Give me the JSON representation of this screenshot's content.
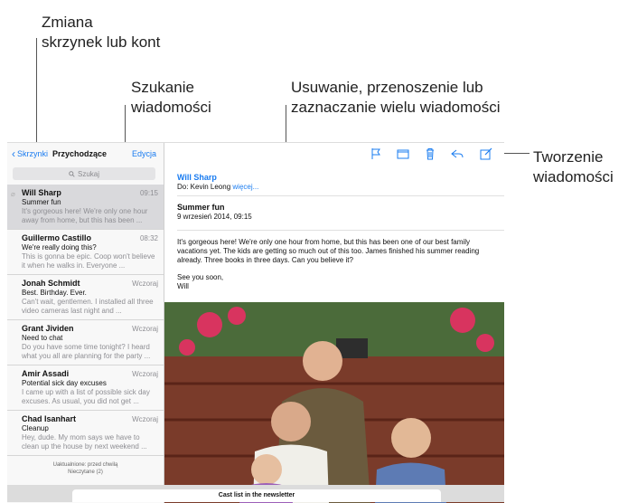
{
  "callouts": {
    "mailboxes": "Zmiana\nskrzynek lub kont",
    "search": "Szukanie\nwiadomości",
    "actions": "Usuwanie, przenoszenie lub\nzaznaczanie wielu wiadomości",
    "compose": "Tworzenie\nwiadomości"
  },
  "nav": {
    "back_label": "Skrzynki",
    "title": "Przychodzące",
    "edit_label": "Edycja"
  },
  "search": {
    "placeholder": "Szukaj"
  },
  "messages": [
    {
      "from": "Will Sharp",
      "date": "09:15",
      "subject": "Summer fun",
      "preview": "It's gorgeous here! We're only one hour away from home, but this has been ..."
    },
    {
      "from": "Guillermo Castillo",
      "date": "08:32",
      "subject": "We're really doing this?",
      "preview": "This is gonna be epic. Coop won't believe it when he walks in. Everyone ..."
    },
    {
      "from": "Jonah Schmidt",
      "date": "Wczoraj",
      "subject": "Best. Birthday. Ever.",
      "preview": "Can't wait, gentlemen. I installed all three video cameras last night and ..."
    },
    {
      "from": "Grant Jividen",
      "date": "Wczoraj",
      "subject": "Need to chat",
      "preview": "Do you have some time tonight? I heard what you all are planning for the party ..."
    },
    {
      "from": "Amir Assadi",
      "date": "Wczoraj",
      "subject": "Potential sick day excuses",
      "preview": "I came up with a list of possible sick day excuses. As usual, you did not get ..."
    },
    {
      "from": "Chad Isanhart",
      "date": "Wczoraj",
      "subject": "Cleanup",
      "preview": "Hey, dude. My mom says we have to clean up the house by next weekend ..."
    }
  ],
  "status": {
    "updated": "Uaktualnione: przed chwilą",
    "unread": "Nieczytane (2)"
  },
  "detail": {
    "sender": "Will Sharp",
    "to_label": "Do: Kevin Leong",
    "more_label": "więcej...",
    "subject": "Summer fun",
    "date": "9 wrzesień 2014, 09:15",
    "body1": "It's gorgeous here! We're only one hour from home, but this has been one of our best family vacations yet. The kids are getting so much out of this too. James finished his summer reading already. Three books in three days. Can you believe it?",
    "body2": "See you soon,",
    "body3": "Will"
  },
  "cast": {
    "title": "Cast list in the newsletter"
  },
  "icons": [
    "chevron-left-icon",
    "search-icon",
    "flag-icon",
    "folder-icon",
    "trash-icon",
    "reply-icon",
    "compose-icon"
  ],
  "colors": {
    "accent": "#1a7cf0",
    "selected_row": "#d9d9dc"
  }
}
